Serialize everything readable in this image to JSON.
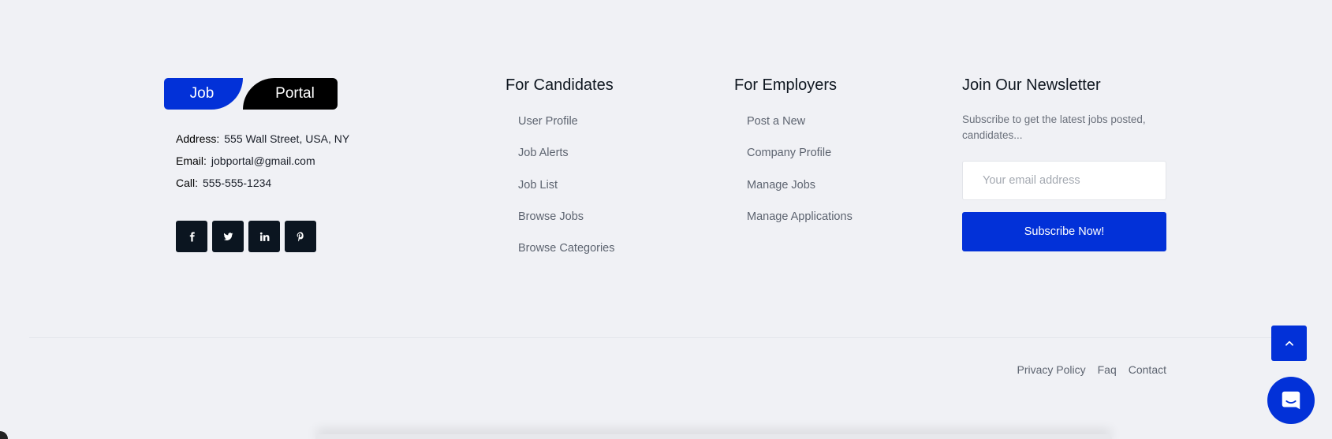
{
  "logo": {
    "left": "Job",
    "right": "Portal"
  },
  "contact": [
    {
      "label": "Address:",
      "value": "555 Wall Street, USA, NY"
    },
    {
      "label": "Email:",
      "value": "jobportal@gmail.com"
    },
    {
      "label": "Call:",
      "value": "555-555-1234"
    }
  ],
  "socials": [
    "facebook-icon",
    "twitter-icon",
    "linkedin-icon",
    "pinterest-icon"
  ],
  "candidates": {
    "title": "For Candidates",
    "items": [
      "User Profile",
      "Job Alerts",
      "Job List",
      "Browse Jobs",
      "Browse Categories"
    ]
  },
  "employers": {
    "title": "For Employers",
    "items": [
      "Post a New",
      "Company Profile",
      "Manage Jobs",
      "Manage Applications"
    ]
  },
  "newsletter": {
    "title": "Join Our Newsletter",
    "description": "Subscribe to get the latest jobs posted, candidates...",
    "placeholder": "Your email address",
    "button": "Subscribe Now!"
  },
  "bottom_links": [
    "Privacy Policy",
    "Faq",
    "Contact"
  ],
  "colors": {
    "accent": "#0231d8",
    "dark": "#0b1520",
    "background": "#f0f1f5"
  }
}
